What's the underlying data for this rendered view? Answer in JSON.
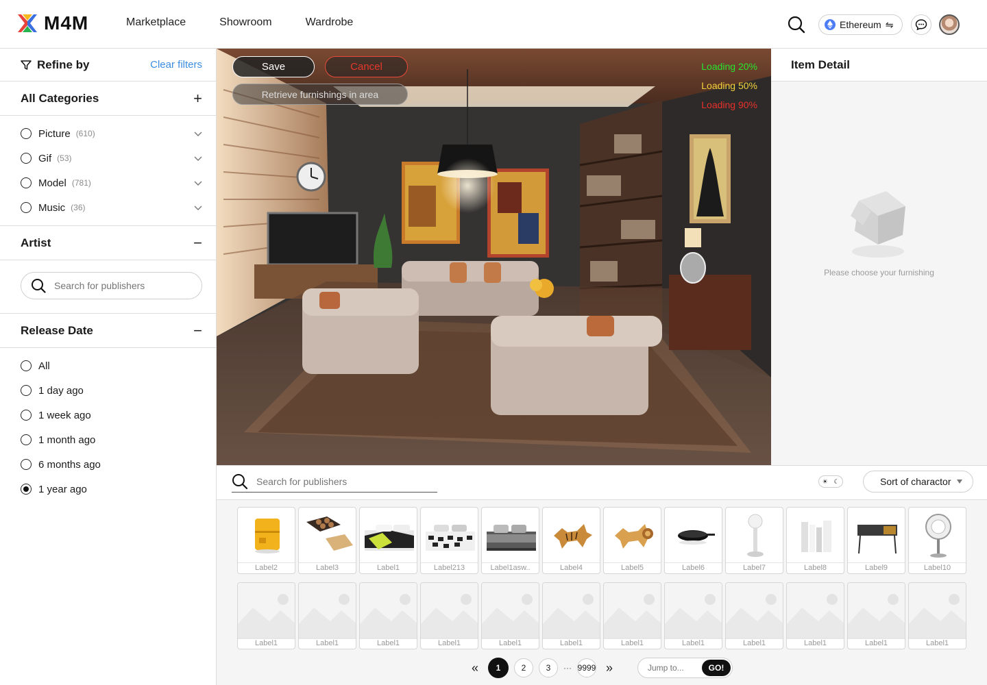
{
  "brand": {
    "name": "M4M"
  },
  "nav": {
    "items": [
      "Marketplace",
      "Showroom",
      "Wardrobe"
    ]
  },
  "header": {
    "chain_label": "Ethereum",
    "chain_swap_icon": "⇋"
  },
  "sidebar": {
    "refine_title": "Refine by",
    "clear_filters": "Clear filters",
    "categories_title": "All Categories",
    "categories": [
      {
        "label": "Picture",
        "count": "(610)"
      },
      {
        "label": "Gif",
        "count": "(53)"
      },
      {
        "label": "Model",
        "count": "(781)"
      },
      {
        "label": "Music",
        "count": "(36)"
      }
    ],
    "artist_title": "Artist",
    "artist_search_placeholder": "Search for publishers",
    "release_title": "Release Date",
    "release_options": [
      "All",
      "1 day ago",
      "1 week ago",
      "1 month ago",
      "6 months ago",
      "1 year ago"
    ],
    "release_selected": "1 year ago"
  },
  "scene": {
    "save": "Save",
    "cancel": "Cancel",
    "retrieve": "Retrieve furnishings in area",
    "loading": [
      "Loading 20%",
      "Loading 50%",
      "Loading 90%"
    ],
    "loading_colors": [
      "#27e52e",
      "#f4d33a",
      "#e8302b"
    ]
  },
  "detail": {
    "title": "Item Detail",
    "empty_text": "Please choose your furnishing"
  },
  "library": {
    "search_placeholder": "Search for publishers",
    "sort_label": "Sort of charactor",
    "items_row1": [
      {
        "label": "Label2",
        "icon": "cabinet"
      },
      {
        "label": "Label3",
        "icon": "stove"
      },
      {
        "label": "Label1",
        "icon": "bed-yellow"
      },
      {
        "label": "Label213",
        "icon": "bed-pattern"
      },
      {
        "label": "Label1asw..",
        "icon": "bed-grey"
      },
      {
        "label": "Label4",
        "icon": "rug-tiger"
      },
      {
        "label": "Label5",
        "icon": "rug-lion"
      },
      {
        "label": "Label6",
        "icon": "pan"
      },
      {
        "label": "Label7",
        "icon": "lamp"
      },
      {
        "label": "Label8",
        "icon": "bookends"
      },
      {
        "label": "Label9",
        "icon": "console"
      },
      {
        "label": "Label10",
        "icon": "chair"
      }
    ],
    "items_row2_label": "Label1",
    "items_row2_count": 12
  },
  "pager": {
    "pages": [
      "1",
      "2",
      "3"
    ],
    "dots": "···",
    "last": "9999",
    "jump_placeholder": "Jump to...",
    "go": "GO!"
  }
}
